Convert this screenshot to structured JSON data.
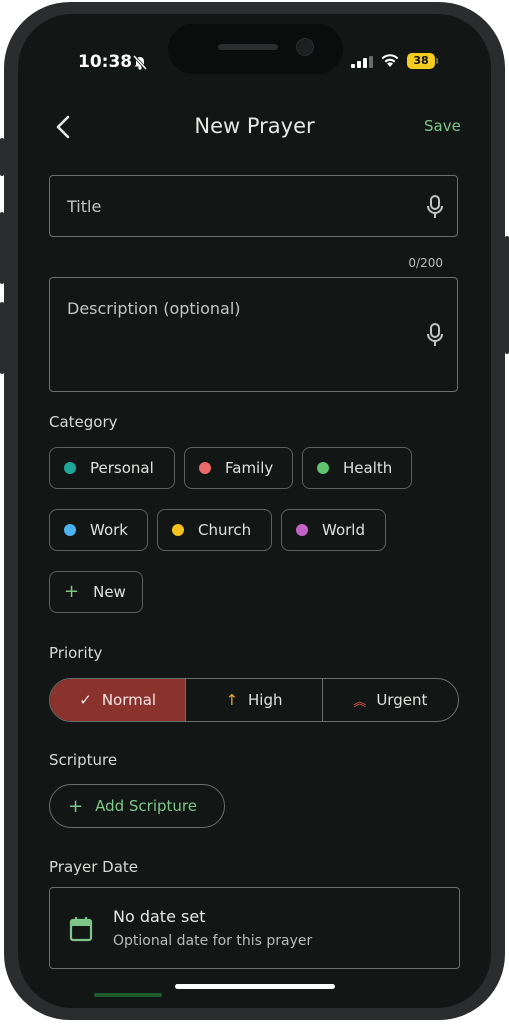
{
  "status": {
    "time": "10:38",
    "battery": "38"
  },
  "header": {
    "title": "New Prayer",
    "save_label": "Save"
  },
  "form": {
    "title_placeholder": "Title",
    "title_counter": "0/200",
    "description_placeholder": "Description (optional)"
  },
  "category": {
    "label": "Category",
    "chips": [
      {
        "label": "Personal",
        "color": "#1ea89a"
      },
      {
        "label": "Family",
        "color": "#ee6a6a"
      },
      {
        "label": "Health",
        "color": "#5ec46f"
      },
      {
        "label": "Work",
        "color": "#4db3f0"
      },
      {
        "label": "Church",
        "color": "#f3c21f"
      },
      {
        "label": "World",
        "color": "#c463c6"
      }
    ],
    "new_label": "New"
  },
  "priority": {
    "label": "Priority",
    "options": [
      "Normal",
      "High",
      "Urgent"
    ],
    "selected": "Normal"
  },
  "scripture": {
    "label": "Scripture",
    "add_label": "Add Scripture"
  },
  "prayer_date": {
    "label": "Prayer Date",
    "value": "No date set",
    "hint": "Optional date for this prayer"
  },
  "colors": {
    "accent": "#7fc68a",
    "priority_active": "#8a322c",
    "background": "#121614"
  }
}
